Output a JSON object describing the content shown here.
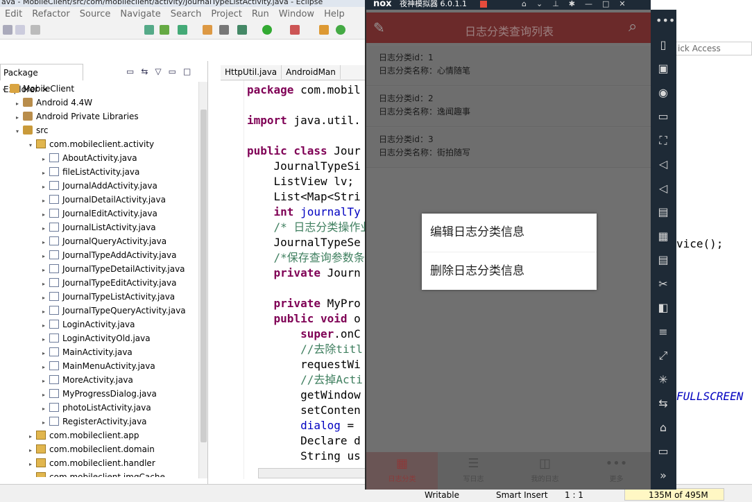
{
  "eclipse": {
    "title": "ava - MobileClient/src/com/mobileclient/activity/JournalTypeListActivity.java - Eclipse",
    "menu": [
      "Edit",
      "Refactor",
      "Source",
      "Navigate",
      "Search",
      "Project",
      "Run",
      "Window",
      "Help"
    ],
    "package_explorer": {
      "tab_label": "Package Explorer",
      "close": "✕",
      "tree": [
        {
          "label": "MobileClient",
          "indent": 0,
          "type": "proj",
          "tw": "▾"
        },
        {
          "label": "Android 4.4W",
          "indent": 1,
          "type": "lib",
          "tw": "▸"
        },
        {
          "label": "Android Private Libraries",
          "indent": 1,
          "type": "lib",
          "tw": "▸"
        },
        {
          "label": "src",
          "indent": 1,
          "type": "src",
          "tw": "▾"
        },
        {
          "label": "com.mobileclient.activity",
          "indent": 2,
          "type": "pkg",
          "tw": "▾"
        },
        {
          "label": "AboutActivity.java",
          "indent": 3,
          "type": "java",
          "tw": "▸"
        },
        {
          "label": "fileListActivity.java",
          "indent": 3,
          "type": "java",
          "tw": "▸"
        },
        {
          "label": "JournalAddActivity.java",
          "indent": 3,
          "type": "java",
          "tw": "▸"
        },
        {
          "label": "JournalDetailActivity.java",
          "indent": 3,
          "type": "java",
          "tw": "▸"
        },
        {
          "label": "JournalEditActivity.java",
          "indent": 3,
          "type": "java",
          "tw": "▸"
        },
        {
          "label": "JournalListActivity.java",
          "indent": 3,
          "type": "java",
          "tw": "▸"
        },
        {
          "label": "JournalQueryActivity.java",
          "indent": 3,
          "type": "java",
          "tw": "▸"
        },
        {
          "label": "JournalTypeAddActivity.java",
          "indent": 3,
          "type": "java",
          "tw": "▸"
        },
        {
          "label": "JournalTypeDetailActivity.java",
          "indent": 3,
          "type": "java",
          "tw": "▸"
        },
        {
          "label": "JournalTypeEditActivity.java",
          "indent": 3,
          "type": "java",
          "tw": "▸"
        },
        {
          "label": "JournalTypeListActivity.java",
          "indent": 3,
          "type": "java",
          "tw": "▸"
        },
        {
          "label": "JournalTypeQueryActivity.java",
          "indent": 3,
          "type": "java",
          "tw": "▸"
        },
        {
          "label": "LoginActivity.java",
          "indent": 3,
          "type": "java",
          "tw": "▸"
        },
        {
          "label": "LoginActivityOld.java",
          "indent": 3,
          "type": "java",
          "tw": "▸"
        },
        {
          "label": "MainActivity.java",
          "indent": 3,
          "type": "java",
          "tw": "▸"
        },
        {
          "label": "MainMenuActivity.java",
          "indent": 3,
          "type": "java",
          "tw": "▸"
        },
        {
          "label": "MoreActivity.java",
          "indent": 3,
          "type": "java",
          "tw": "▸"
        },
        {
          "label": "MyProgressDialog.java",
          "indent": 3,
          "type": "java",
          "tw": "▸"
        },
        {
          "label": "photoListActivity.java",
          "indent": 3,
          "type": "java",
          "tw": "▸"
        },
        {
          "label": "RegisterActivity.java",
          "indent": 3,
          "type": "java",
          "tw": "▸"
        },
        {
          "label": "com.mobileclient.app",
          "indent": 2,
          "type": "pkg",
          "tw": "▸"
        },
        {
          "label": "com.mobileclient.domain",
          "indent": 2,
          "type": "pkg",
          "tw": "▸"
        },
        {
          "label": "com.mobileclient.handler",
          "indent": 2,
          "type": "pkg",
          "tw": "▸"
        },
        {
          "label": "com.mobileclient.imgCache",
          "indent": 2,
          "type": "pkg",
          "tw": "▸"
        }
      ]
    },
    "editor_tabs": [
      "HttpUtil.java",
      "AndroidMan"
    ],
    "code_lines": [
      "<span class='kw'>package</span> com.mobil",
      "",
      "<span class='kw'>import</span> java.util.",
      "",
      "<span class='kw'>public class</span> Jour",
      "    JournalTypeSi",
      "    ListView lv;",
      "    List&lt;Map&lt;Stri",
      "    <span class='kw'>int</span> <span class='fd'>journalTy</span>",
      "    <span class='cm'>/* 日志分类操作业</span>",
      "    JournalTypeSe",
      "    <span class='cm'>/*保存查询参数条</span>",
      "    <span class='kw'>private</span> Journ",
      "",
      "    <span class='kw'>private</span> MyPro",
      "    <span class='kw'>public void</span> o",
      "        <span class='kw'>super</span>.onC",
      "        <span class='cm'>//去除titl</span>",
      "        requestWi",
      "        <span class='cm'>//去掉Acti</span>",
      "        getWindow",
      "        setConten",
      "        <span class='fd'>dialog</span> =",
      "        Declare d",
      "        String us"
    ],
    "right_code_1": "vice();",
    "right_code_2": "FULLSCREEN",
    "quick_access": "ick Access",
    "status": {
      "writable": "Writable",
      "insert": "Smart Insert",
      "position": "1 : 1",
      "heap": "135M of 495M"
    }
  },
  "nox": {
    "logo": "nox",
    "version": "夜神模拟器 6.0.1.1",
    "app": {
      "title": "日志分类查询列表",
      "items": [
        {
          "id_label": "日志分类id：1",
          "name_label": "日志分类名称：心情随笔"
        },
        {
          "id_label": "日志分类id：2",
          "name_label": "日志分类名称：逸闻趣事"
        },
        {
          "id_label": "日志分类id：3",
          "name_label": "日志分类名称：街拍随写"
        }
      ],
      "dialog_options": [
        "编辑日志分类信息",
        "删除日志分类信息"
      ],
      "bottom_nav": [
        {
          "label": "日志分类",
          "icon": "▦",
          "active": true
        },
        {
          "label": "写日志",
          "icon": "☰",
          "active": false
        },
        {
          "label": "我的日志",
          "icon": "◫",
          "active": false
        },
        {
          "label": "更多",
          "icon": "•••",
          "active": false
        }
      ]
    },
    "sidebar_icons": [
      "•••",
      "▯",
      "▣",
      "◉",
      "▭",
      "⛶",
      "◁",
      "◁",
      "▤",
      "▦",
      "▤",
      "✂",
      "◧",
      "≡",
      "⤢",
      "✳",
      "⇆",
      "⌂",
      "▭",
      "»"
    ]
  }
}
